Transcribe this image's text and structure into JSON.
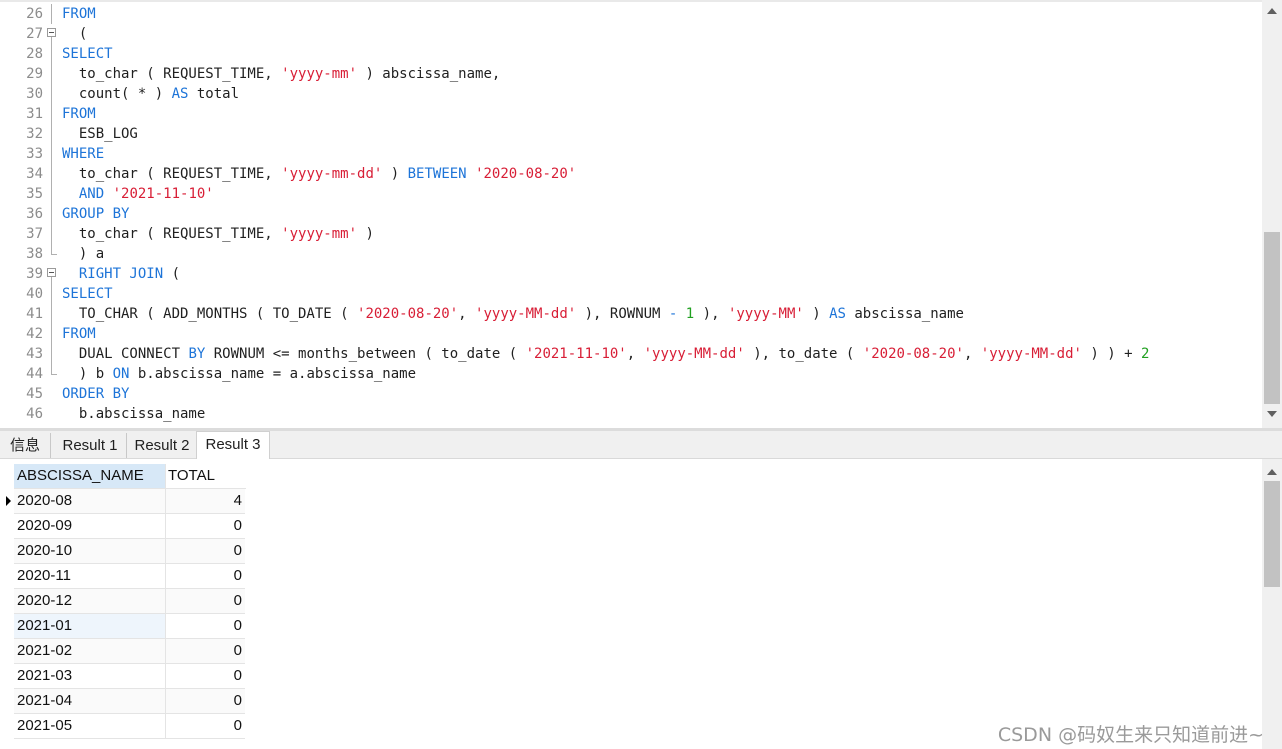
{
  "editor": {
    "lines": [
      {
        "n": "26",
        "fold": "line",
        "tokens": [
          {
            "t": "FROM",
            "c": "kw"
          }
        ]
      },
      {
        "n": "27",
        "fold": "start",
        "tokens": [
          {
            "t": "  (",
            "c": "plain"
          }
        ]
      },
      {
        "n": "28",
        "fold": "line",
        "tokens": [
          {
            "t": "SELECT",
            "c": "kw"
          }
        ]
      },
      {
        "n": "29",
        "fold": "line",
        "tokens": [
          {
            "t": "  to_char ( REQUEST_TIME, ",
            "c": "plain"
          },
          {
            "t": "'yyyy-mm'",
            "c": "str"
          },
          {
            "t": " ) abscissa_name,",
            "c": "plain"
          }
        ]
      },
      {
        "n": "30",
        "fold": "line",
        "tokens": [
          {
            "t": "  count( * ) ",
            "c": "plain"
          },
          {
            "t": "AS",
            "c": "kw"
          },
          {
            "t": " total",
            "c": "plain"
          }
        ]
      },
      {
        "n": "31",
        "fold": "line",
        "tokens": [
          {
            "t": "FROM",
            "c": "kw"
          }
        ]
      },
      {
        "n": "32",
        "fold": "line",
        "tokens": [
          {
            "t": "  ESB_LOG",
            "c": "plain"
          }
        ]
      },
      {
        "n": "33",
        "fold": "line",
        "tokens": [
          {
            "t": "WHERE",
            "c": "kw"
          }
        ]
      },
      {
        "n": "34",
        "fold": "line",
        "tokens": [
          {
            "t": "  to_char ( REQUEST_TIME, ",
            "c": "plain"
          },
          {
            "t": "'yyyy-mm-dd'",
            "c": "str"
          },
          {
            "t": " ) ",
            "c": "plain"
          },
          {
            "t": "BETWEEN",
            "c": "kw"
          },
          {
            "t": " ",
            "c": "plain"
          },
          {
            "t": "'2020-08-20'",
            "c": "str"
          }
        ]
      },
      {
        "n": "35",
        "fold": "line",
        "tokens": [
          {
            "t": "  ",
            "c": "plain"
          },
          {
            "t": "AND",
            "c": "kw"
          },
          {
            "t": " ",
            "c": "plain"
          },
          {
            "t": "'2021-11-10'",
            "c": "str"
          }
        ]
      },
      {
        "n": "36",
        "fold": "line",
        "tokens": [
          {
            "t": "GROUP BY",
            "c": "kw"
          }
        ]
      },
      {
        "n": "37",
        "fold": "line",
        "tokens": [
          {
            "t": "  to_char ( REQUEST_TIME, ",
            "c": "plain"
          },
          {
            "t": "'yyyy-mm'",
            "c": "str"
          },
          {
            "t": " )",
            "c": "plain"
          }
        ]
      },
      {
        "n": "38",
        "fold": "end",
        "tokens": [
          {
            "t": "  ) a",
            "c": "plain"
          }
        ]
      },
      {
        "n": "39",
        "fold": "start",
        "tokens": [
          {
            "t": "  ",
            "c": "plain"
          },
          {
            "t": "RIGHT JOIN",
            "c": "kw"
          },
          {
            "t": " (",
            "c": "plain"
          }
        ]
      },
      {
        "n": "40",
        "fold": "line",
        "tokens": [
          {
            "t": "SELECT",
            "c": "kw"
          }
        ]
      },
      {
        "n": "41",
        "fold": "line",
        "tokens": [
          {
            "t": "  TO_CHAR ( ADD_MONTHS ( TO_DATE ( ",
            "c": "plain"
          },
          {
            "t": "'2020-08-20'",
            "c": "str"
          },
          {
            "t": ", ",
            "c": "plain"
          },
          {
            "t": "'yyyy-MM-dd'",
            "c": "str"
          },
          {
            "t": " ), ROWNUM ",
            "c": "plain"
          },
          {
            "t": "-",
            "c": "op"
          },
          {
            "t": " ",
            "c": "plain"
          },
          {
            "t": "1",
            "c": "num"
          },
          {
            "t": " ), ",
            "c": "plain"
          },
          {
            "t": "'yyyy-MM'",
            "c": "str"
          },
          {
            "t": " ) ",
            "c": "plain"
          },
          {
            "t": "AS",
            "c": "kw"
          },
          {
            "t": " abscissa_name",
            "c": "plain"
          }
        ]
      },
      {
        "n": "42",
        "fold": "line",
        "tokens": [
          {
            "t": "FROM",
            "c": "kw"
          }
        ]
      },
      {
        "n": "43",
        "fold": "line",
        "tokens": [
          {
            "t": "  DUAL CONNECT ",
            "c": "plain"
          },
          {
            "t": "BY",
            "c": "kw"
          },
          {
            "t": " ROWNUM <= months_between ( to_date ( ",
            "c": "plain"
          },
          {
            "t": "'2021-11-10'",
            "c": "str"
          },
          {
            "t": ", ",
            "c": "plain"
          },
          {
            "t": "'yyyy-MM-dd'",
            "c": "str"
          },
          {
            "t": " ), to_date ( ",
            "c": "plain"
          },
          {
            "t": "'2020-08-20'",
            "c": "str"
          },
          {
            "t": ", ",
            "c": "plain"
          },
          {
            "t": "'yyyy-MM-dd'",
            "c": "str"
          },
          {
            "t": " ) ) + ",
            "c": "plain"
          },
          {
            "t": "2",
            "c": "num"
          }
        ]
      },
      {
        "n": "44",
        "fold": "end",
        "tokens": [
          {
            "t": "  ) b ",
            "c": "plain"
          },
          {
            "t": "ON",
            "c": "kw"
          },
          {
            "t": " b.abscissa_name = a.abscissa_name",
            "c": "plain"
          }
        ]
      },
      {
        "n": "45",
        "fold": "none",
        "tokens": [
          {
            "t": "ORDER BY",
            "c": "kw"
          }
        ]
      },
      {
        "n": "46",
        "fold": "none",
        "tokens": [
          {
            "t": "  b.abscissa_name",
            "c": "plain"
          }
        ]
      }
    ],
    "colors": {
      "keyword": "#1d74d8",
      "string": "#d81e36",
      "number": "#20a020",
      "text": "#1f1f1f"
    }
  },
  "tabs": [
    {
      "label": "信息",
      "active": false
    },
    {
      "label": "Result 1",
      "active": false
    },
    {
      "label": "Result 2",
      "active": false
    },
    {
      "label": "Result 3",
      "active": true
    }
  ],
  "results": {
    "columns": [
      "ABSCISSA_NAME",
      "TOTAL"
    ],
    "rows": [
      [
        "2020-08",
        "4"
      ],
      [
        "2020-09",
        "0"
      ],
      [
        "2020-10",
        "0"
      ],
      [
        "2020-11",
        "0"
      ],
      [
        "2020-12",
        "0"
      ],
      [
        "2021-01",
        "0"
      ],
      [
        "2021-02",
        "0"
      ],
      [
        "2021-03",
        "0"
      ],
      [
        "2021-04",
        "0"
      ],
      [
        "2021-05",
        "0"
      ]
    ],
    "current_row": 0
  },
  "watermark": "CSDN @码奴生来只知道前进~"
}
